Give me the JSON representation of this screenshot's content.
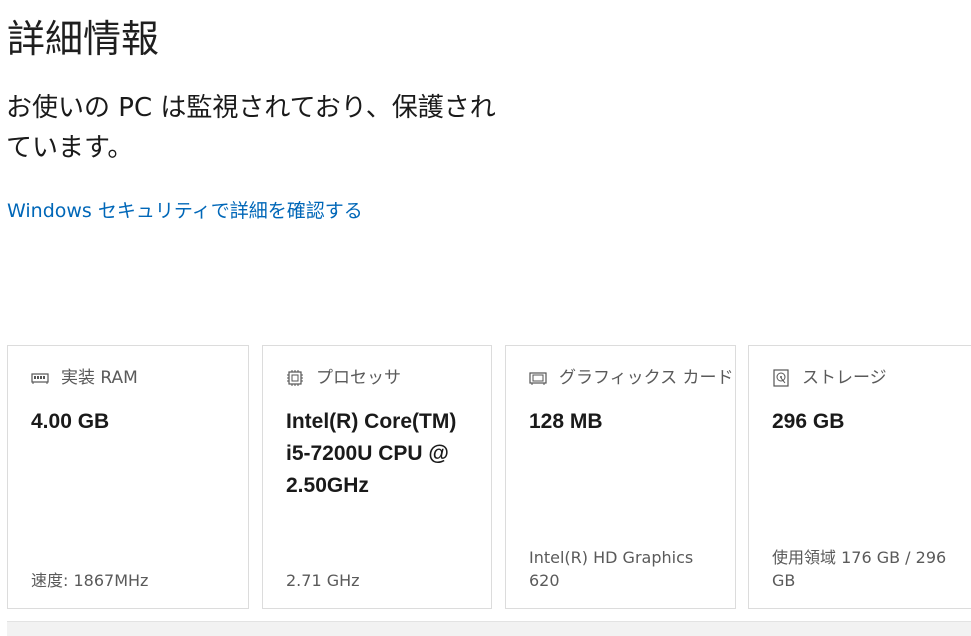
{
  "header": {
    "title": "詳細情報"
  },
  "protection": {
    "message": "お使いの PC は監視されており、保護されています。",
    "link_text": "Windows セキュリティで詳細を確認する"
  },
  "cards": [
    {
      "icon": "ram-icon",
      "label": "実装 RAM",
      "value": "4.00 GB",
      "footer": "速度: 1867MHz"
    },
    {
      "icon": "processor-icon",
      "label": "プロセッサ",
      "value": "Intel(R) Core(TM) i5-7200U CPU @ 2.50GHz",
      "footer": "2.71 GHz"
    },
    {
      "icon": "graphics-card-icon",
      "label": "グラフィックス カード",
      "value": "128 MB",
      "footer": "Intel(R) HD Graphics 620"
    },
    {
      "icon": "storage-icon",
      "label": "ストレージ",
      "value": "296 GB",
      "footer": "使用領域 176 GB / 296 GB"
    }
  ],
  "colors": {
    "link": "#0067b8",
    "card_border": "#dcdcdc",
    "label": "#5a5a5a"
  }
}
